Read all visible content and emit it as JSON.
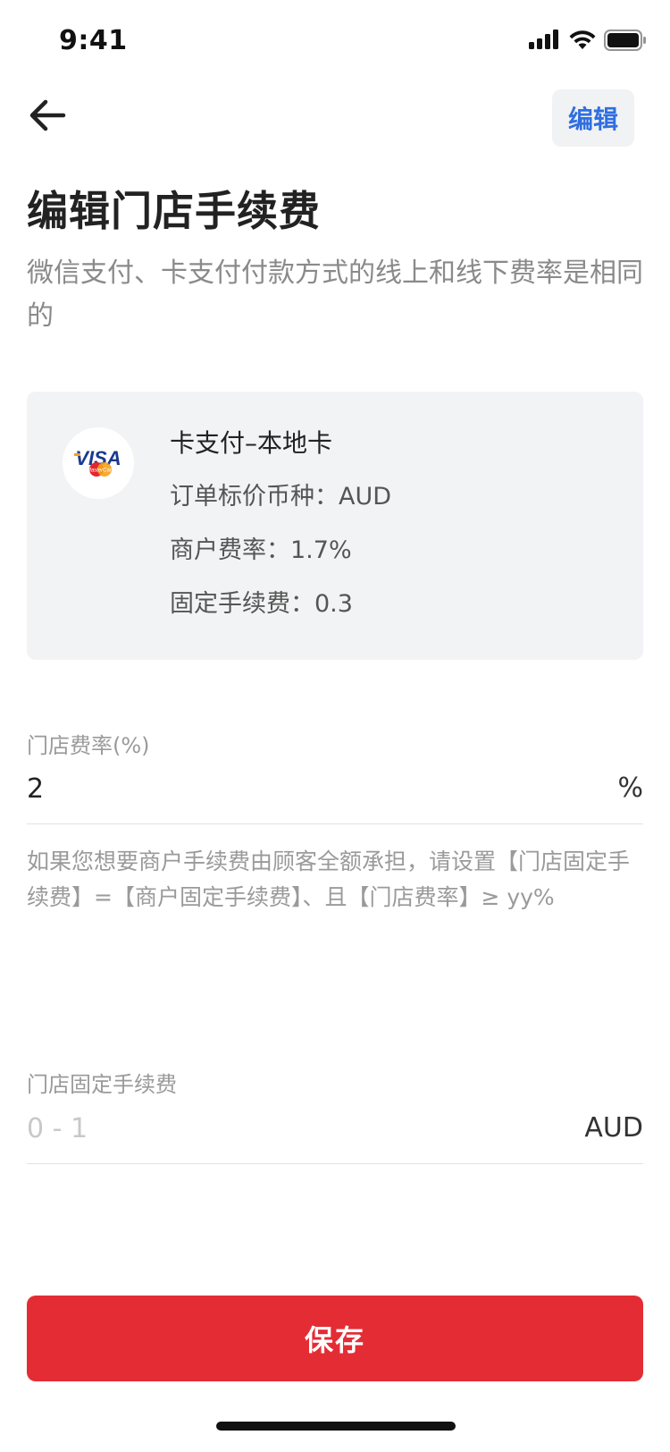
{
  "status_bar": {
    "time": "9:41"
  },
  "nav": {
    "edit_label": "编辑"
  },
  "page": {
    "title": "编辑门店手续费",
    "subtitle": "微信支付、卡支付付款方式的线上和线下费率是相同的"
  },
  "card": {
    "logo_icon": "visa-mastercard-icon",
    "logo_text": "VISA",
    "logo_subtext": "MasterCard",
    "method_name": "卡支付–本地卡",
    "currency_line": "订单标价币种：AUD",
    "merchant_rate_line": "商户费率：1.7%",
    "fixed_fee_line": "固定手续费：0.3"
  },
  "store_rate": {
    "label": "门店费率(%)",
    "value": "2",
    "unit": "%"
  },
  "hint": "如果您想要商户手续费由顾客全额承担，请设置【门店固定手续费】=【商户固定手续费】、且【门店费率】≥ yy%",
  "store_fixed_fee": {
    "label": "门店固定手续费",
    "placeholder": "0 - 1",
    "value": "",
    "unit": "AUD"
  },
  "save_label": "保存",
  "colors": {
    "accent_blue": "#2f6fe0",
    "primary_red": "#e42c35",
    "card_bg": "#f2f3f5"
  }
}
